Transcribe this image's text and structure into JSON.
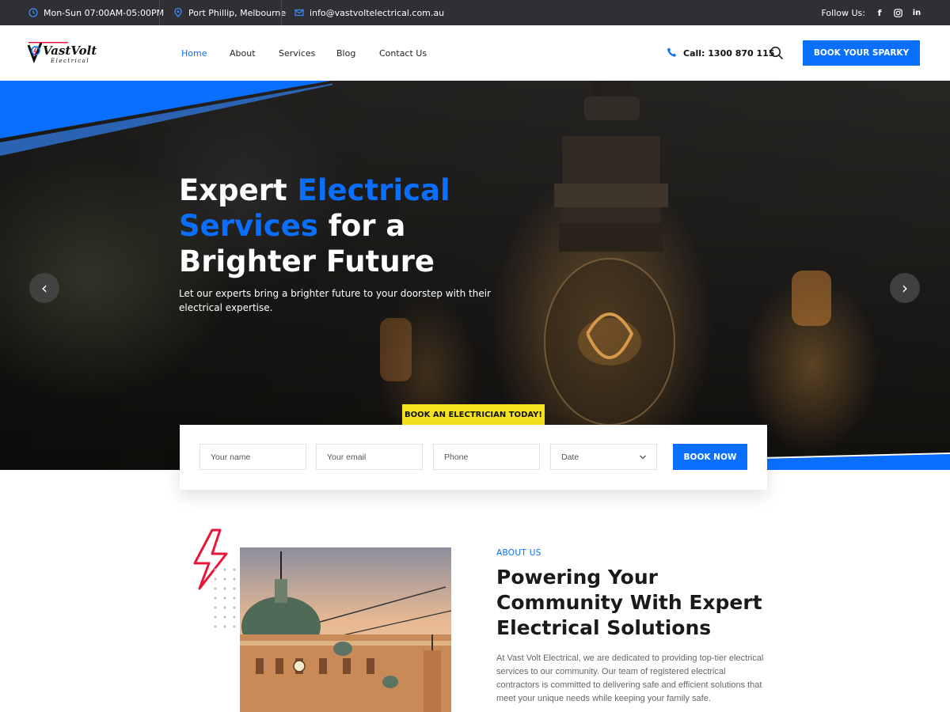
{
  "topbar": {
    "hours": "Mon-Sun 07:00AM-05:00PM",
    "location": "Port Phillip, Melbourne",
    "email": "info@vastvoltelectrical.com.au",
    "follow_label": "Follow Us:",
    "socials": [
      "f",
      "instagram",
      "in"
    ]
  },
  "header": {
    "logo_text": "VastVolt",
    "logo_sub": "Electrical",
    "nav": [
      "Home",
      "About",
      "Services",
      "Blog",
      "Contact Us"
    ],
    "active_nav": "Home",
    "call": "Call: 1300 870 115",
    "cta": "BOOK YOUR SPARKY"
  },
  "hero": {
    "title_part1": "Expert ",
    "title_part2": "Electrical Services",
    "title_part3": " for a Brighter Future",
    "subtitle": "Let our experts bring a brighter future to your doorstep with their electrical expertise.",
    "prev_icon": "‹",
    "next_icon": "›"
  },
  "booking": {
    "tag": "BOOK AN ELECTRICIAN TODAY!",
    "name_placeholder": "Your name",
    "email_placeholder": "Your email",
    "phone_placeholder": "Phone",
    "date_placeholder": "Date",
    "submit": "BOOK NOW"
  },
  "about": {
    "label": "ABOUT US",
    "title": "Powering Your Community With Expert Electrical Solutions",
    "text": "At Vast Volt Electrical, we are dedicated to providing top-tier electrical services to our community. Our team of registered electrical contractors is committed to delivering safe and efficient solutions that meet your unique needs while keeping your family safe."
  },
  "colors": {
    "accent": "#0a6fff",
    "topbar": "#2f3034",
    "tag": "#f6e31d",
    "bolt": "#e8173a"
  }
}
